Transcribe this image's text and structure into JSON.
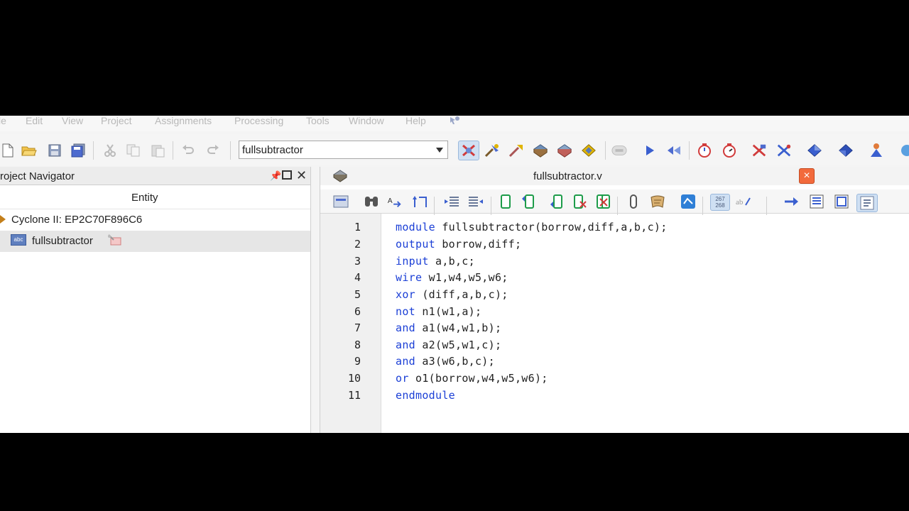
{
  "menu": {
    "items": [
      "le",
      "Edit",
      "View",
      "Project",
      "Assignments",
      "Processing",
      "Tools",
      "Window",
      "Help"
    ]
  },
  "toolbar": {
    "entity_select_value": "fullsubtractor"
  },
  "navigator": {
    "title": "roject Navigator",
    "column_header": "Entity",
    "device": "Cyclone II: EP2C70F896C6",
    "top_module": "fullsubtractor"
  },
  "editor": {
    "tab_title": "fullsubtractor.v",
    "close_label": "×",
    "lines": [
      {
        "num": "1",
        "kw": "module",
        "rest": " fullsubtractor(borrow,diff,a,b,c);"
      },
      {
        "num": "2",
        "kw": "output",
        "rest": " borrow,diff;"
      },
      {
        "num": "3",
        "kw": "input",
        "rest": " a,b,c;"
      },
      {
        "num": "4",
        "kw": "wire",
        "rest": " w1,w4,w5,w6;"
      },
      {
        "num": "5",
        "kw": "xor",
        "rest": " (diff,a,b,c);"
      },
      {
        "num": "6",
        "kw": "not",
        "rest": " n1(w1,a);"
      },
      {
        "num": "7",
        "kw": "and",
        "rest": " a1(w4,w1,b);"
      },
      {
        "num": "8",
        "kw": "and",
        "rest": " a2(w5,w1,c);"
      },
      {
        "num": "9",
        "kw": "and",
        "rest": " a3(w6,b,c);"
      },
      {
        "num": "10",
        "kw": "or",
        "rest": " o1(borrow,w4,w5,w6);"
      },
      {
        "num": "11",
        "kw": "endmodule",
        "rest": ""
      }
    ]
  },
  "colors": {
    "keyword": "#1b3fd6",
    "close_button": "#f26a3c",
    "menu_text": "#b8b8b8"
  },
  "icons": {
    "toolbar": [
      "new-file-icon",
      "open-folder-icon",
      "save-icon",
      "save-all-icon",
      "cut-icon",
      "copy-icon",
      "paste-icon",
      "undo-icon",
      "redo-icon",
      "compile-icon",
      "analysis-icon",
      "rtl-viewer-icon",
      "pin-planner-icon",
      "settings-icon",
      "chip-icon",
      "stop-icon",
      "start-icon",
      "rerun-icon",
      "timing-icon",
      "timer-icon",
      "netlist-icon",
      "chip-planner-icon",
      "assembler-icon",
      "programmer-icon",
      "signaltap-icon",
      "help-icon"
    ],
    "editor_toolbar": [
      "insert-template-icon",
      "find-icon",
      "replace-icon",
      "goto-icon",
      "indent-icon",
      "unindent-icon",
      "bookmark-icon",
      "prev-bookmark-icon",
      "next-bookmark-icon",
      "remove-bookmark-icon",
      "clear-bookmarks-icon",
      "comment-icon",
      "uncomment-icon",
      "block-icon",
      "line-numbers-icon",
      "spell-icon",
      "goto-line-icon",
      "split-icon",
      "fullscreen-icon",
      "detach-icon"
    ]
  }
}
